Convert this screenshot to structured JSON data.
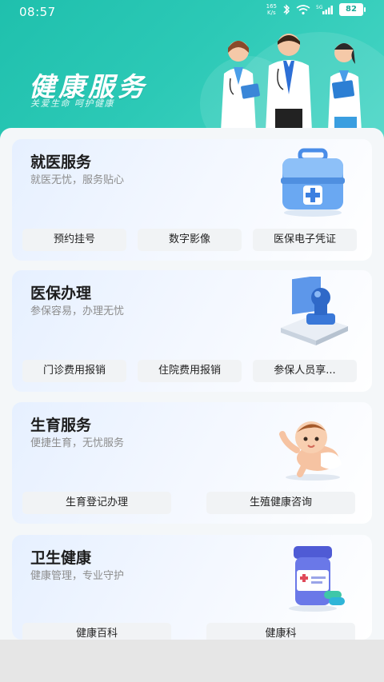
{
  "status_bar": {
    "time": "08:57",
    "net_speed_top": "165",
    "net_speed_bottom": "K/s",
    "battery": "82"
  },
  "header": {
    "title": "健康服务",
    "subtitle": "关爱生命  呵护健康"
  },
  "sections": [
    {
      "title": "就医服务",
      "subtitle": "就医无忧，服务贴心",
      "icon": "medical-kit-icon",
      "buttons": [
        "预约挂号",
        "数字影像",
        "医保电子凭证"
      ]
    },
    {
      "title": "医保办理",
      "subtitle": "参保容易，办理无忧",
      "icon": "stamp-icon",
      "buttons": [
        "门诊费用报销",
        "住院费用报销",
        "参保人员享..."
      ]
    },
    {
      "title": "生育服务",
      "subtitle": "便捷生育，无忧服务",
      "icon": "baby-icon",
      "buttons": [
        "生育登记办理",
        "生殖健康咨询"
      ]
    },
    {
      "title": "卫生健康",
      "subtitle": "健康管理，专业守护",
      "icon": "medicine-bottle-icon",
      "buttons": [
        "健康百科",
        "健康科"
      ]
    }
  ],
  "colors": {
    "header_start": "#1fc0ad",
    "header_end": "#49d6c6",
    "card_tint": "#e6f0ff"
  }
}
